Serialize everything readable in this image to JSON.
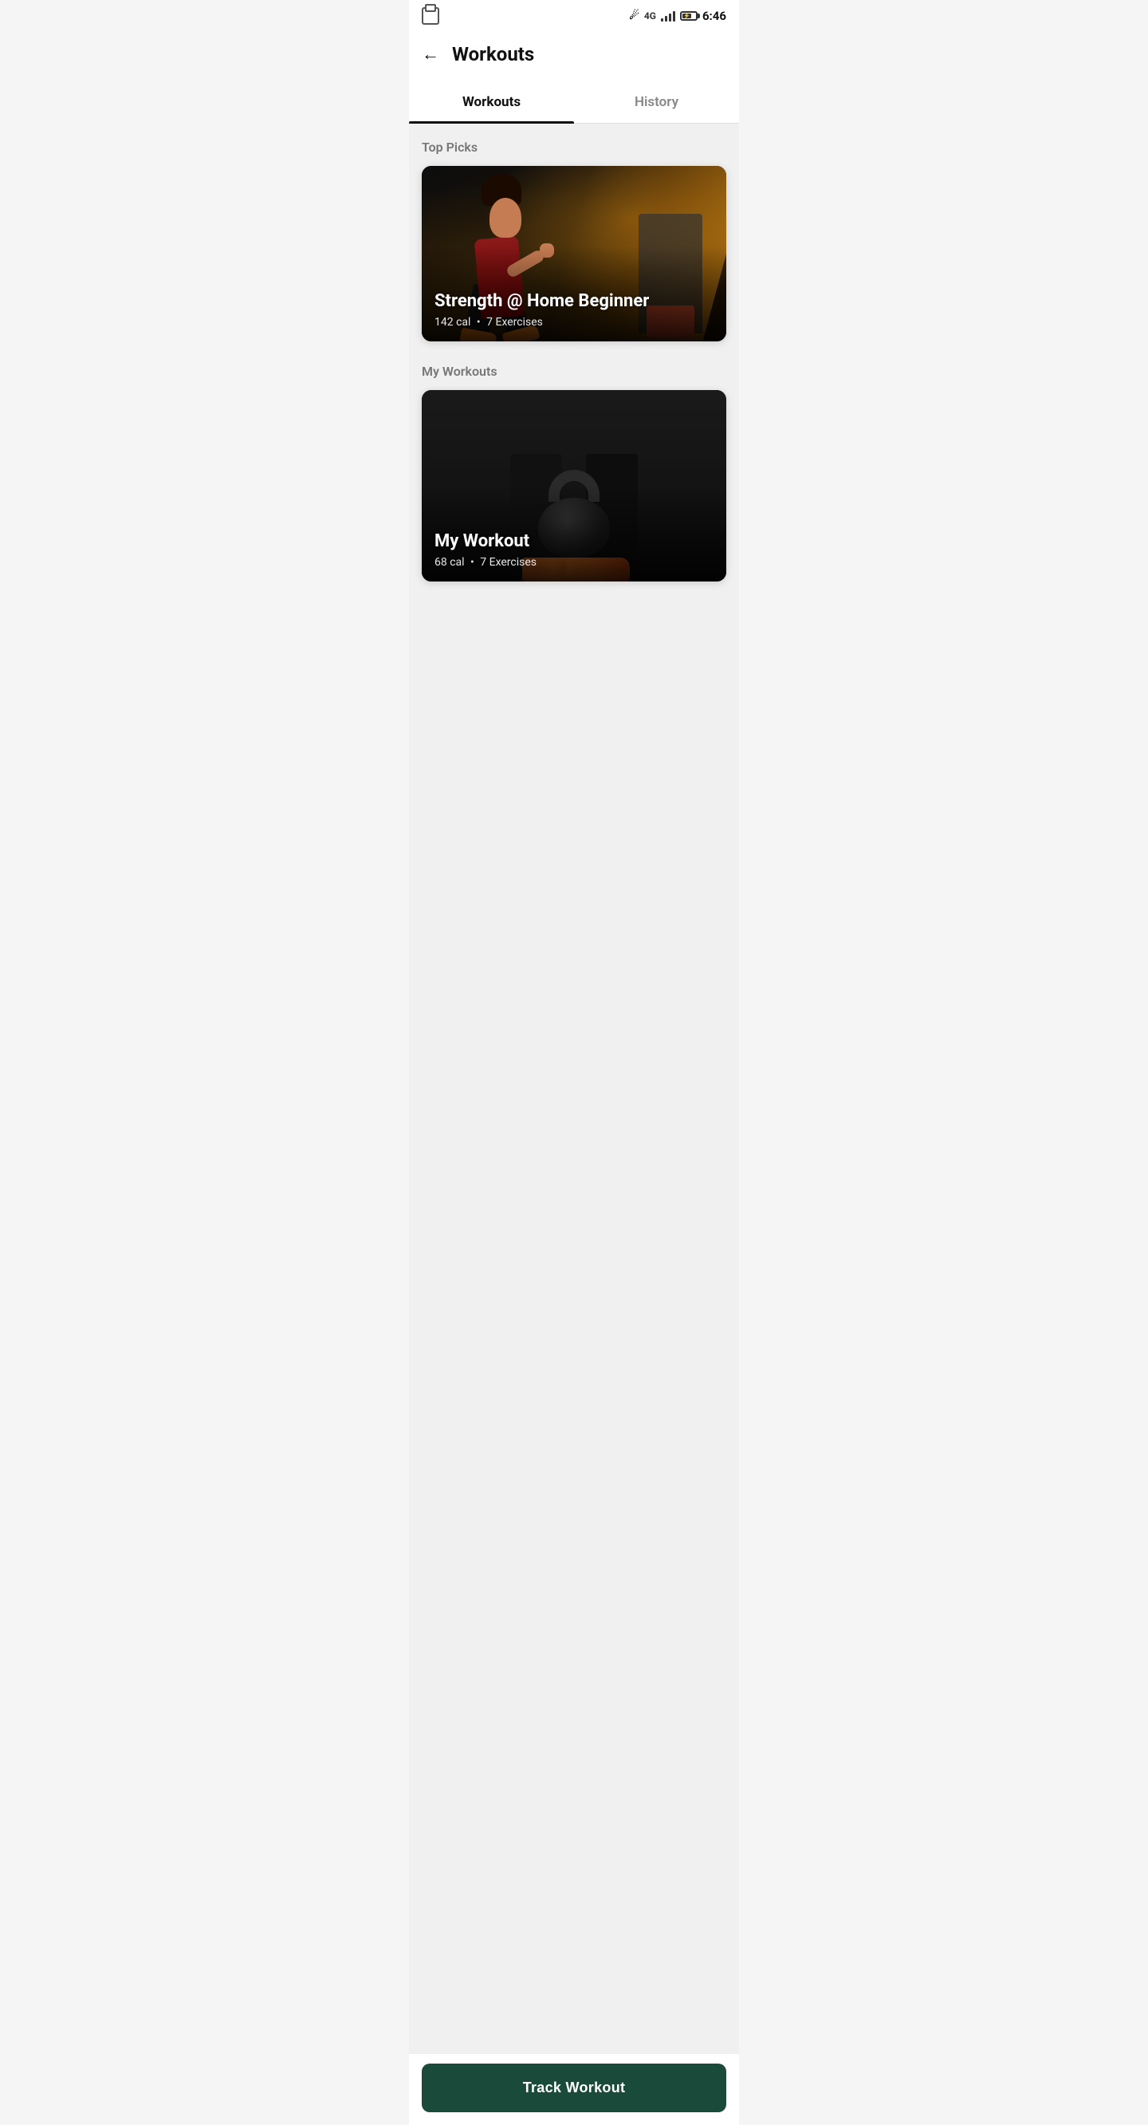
{
  "statusBar": {
    "time": "6:46",
    "bluetooth": "⚡",
    "network": "4G"
  },
  "header": {
    "title": "Workouts",
    "backLabel": "←"
  },
  "tabs": [
    {
      "id": "workouts",
      "label": "Workouts",
      "active": true
    },
    {
      "id": "history",
      "label": "History",
      "active": false
    }
  ],
  "sections": {
    "topPicks": {
      "title": "Top Picks",
      "card": {
        "name": "Strength @ Home Beginner",
        "calories": "142 cal",
        "exercises": "7 Exercises",
        "separator": "•"
      }
    },
    "myWorkouts": {
      "title": "My Workouts",
      "card": {
        "name": "My Workout",
        "calories": "68 cal",
        "exercises": "7 Exercises",
        "separator": "•"
      }
    }
  },
  "trackButton": {
    "label": "Track Workout"
  }
}
